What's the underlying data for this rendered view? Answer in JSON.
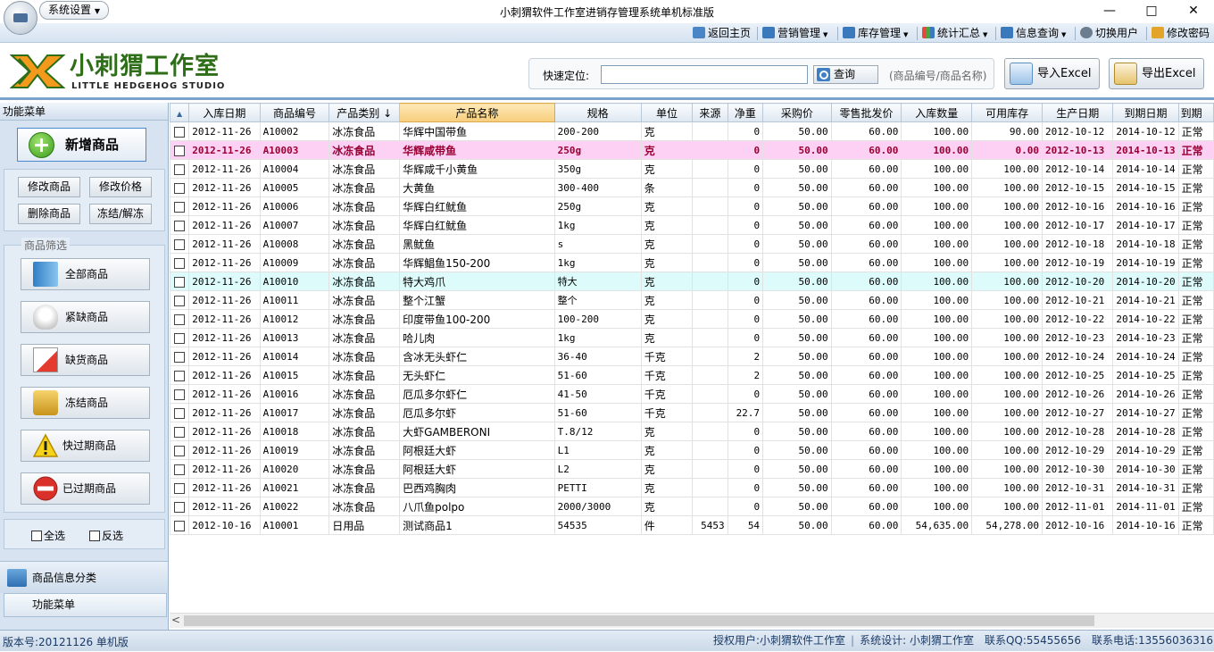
{
  "app": {
    "title": "小刺猬软件工作室进销存管理系统单机标准版",
    "settings_menu": "系统设置",
    "controls": {
      "minimize": "—",
      "maximize": "□",
      "close": "✕"
    }
  },
  "menubar": [
    {
      "label": "返回主页",
      "icon": "home-icon",
      "dropdown": false
    },
    {
      "label": "营销管理",
      "icon": "sales-icon",
      "dropdown": true
    },
    {
      "label": "库存管理",
      "icon": "inventory-icon",
      "dropdown": true
    },
    {
      "label": "统计汇总",
      "icon": "stats-icon",
      "dropdown": true
    },
    {
      "label": "信息查询",
      "icon": "query-icon",
      "dropdown": true
    },
    {
      "label": "切换用户",
      "icon": "switch-user-icon",
      "dropdown": false
    },
    {
      "label": "修改密码",
      "icon": "lock-icon",
      "dropdown": false
    }
  ],
  "header": {
    "logo_cn": "小刺猬工作室",
    "logo_en": "LITTLE HEDGEHOG STUDIO",
    "search_label": "快速定位:",
    "search_value": "",
    "search_button": "查询",
    "search_hint": "(商品编号/商品名称)",
    "import_label": "导入Excel",
    "export_label": "导出Excel"
  },
  "sidebar": {
    "title": "功能菜单",
    "new_item": "新增商品",
    "edit_item": "修改商品",
    "edit_price": "修改价格",
    "delete_item": "删除商品",
    "freeze": "冻结/解冻",
    "filter_group": "商品筛选",
    "filters": [
      {
        "label": "全部商品",
        "icon": "all-items-icon"
      },
      {
        "label": "紧缺商品",
        "icon": "lightbulb-icon"
      },
      {
        "label": "缺货商品",
        "icon": "out-of-stock-icon"
      },
      {
        "label": "冻结商品",
        "icon": "padlock-icon"
      },
      {
        "label": "快过期商品",
        "icon": "warning-icon"
      },
      {
        "label": "已过期商品",
        "icon": "no-entry-icon"
      }
    ],
    "select_all": "全选",
    "invert": "反选",
    "category": "商品信息分类",
    "func_menu": "功能菜单"
  },
  "table": {
    "sort_column": "产品类别",
    "sort_indicator": "↓",
    "columns": [
      "入库日期",
      "商品编号",
      "产品类别",
      "产品名称",
      "规格",
      "单位",
      "来源",
      "净重",
      "采购价",
      "零售批发价",
      "入库数量",
      "可用库存",
      "生产日期",
      "到期日期",
      "到期"
    ],
    "rows": [
      {
        "d": "2012-11-26",
        "id": "A10002",
        "cat": "冰冻食品",
        "name": "华辉中国带鱼",
        "spec": "200-200",
        "unit": "克",
        "src": "",
        "wt": "0",
        "buy": "50.00",
        "sell": "60.00",
        "qin": "100.00",
        "stock": "90.00",
        "prod": "2012-10-12",
        "exp": "2014-10-12",
        "st": "正常",
        "cls": ""
      },
      {
        "d": "2012-11-26",
        "id": "A10003",
        "cat": "冰冻食品",
        "name": "华辉咸带鱼",
        "spec": "250g",
        "unit": "克",
        "src": "",
        "wt": "0",
        "buy": "50.00",
        "sell": "60.00",
        "qin": "100.00",
        "stock": "0.00",
        "prod": "2012-10-13",
        "exp": "2014-10-13",
        "st": "正常",
        "cls": "row-warn"
      },
      {
        "d": "2012-11-26",
        "id": "A10004",
        "cat": "冰冻食品",
        "name": "华辉咸千小黄鱼",
        "spec": "350g",
        "unit": "克",
        "src": "",
        "wt": "0",
        "buy": "50.00",
        "sell": "60.00",
        "qin": "100.00",
        "stock": "100.00",
        "prod": "2012-10-14",
        "exp": "2014-10-14",
        "st": "正常",
        "cls": ""
      },
      {
        "d": "2012-11-26",
        "id": "A10005",
        "cat": "冰冻食品",
        "name": "大黄鱼",
        "spec": "300-400",
        "unit": "条",
        "src": "",
        "wt": "0",
        "buy": "50.00",
        "sell": "60.00",
        "qin": "100.00",
        "stock": "100.00",
        "prod": "2012-10-15",
        "exp": "2014-10-15",
        "st": "正常",
        "cls": ""
      },
      {
        "d": "2012-11-26",
        "id": "A10006",
        "cat": "冰冻食品",
        "name": "华辉白红鱿鱼",
        "spec": "250g",
        "unit": "克",
        "src": "",
        "wt": "0",
        "buy": "50.00",
        "sell": "60.00",
        "qin": "100.00",
        "stock": "100.00",
        "prod": "2012-10-16",
        "exp": "2014-10-16",
        "st": "正常",
        "cls": ""
      },
      {
        "d": "2012-11-26",
        "id": "A10007",
        "cat": "冰冻食品",
        "name": "华辉白红鱿鱼",
        "spec": "1kg",
        "unit": "克",
        "src": "",
        "wt": "0",
        "buy": "50.00",
        "sell": "60.00",
        "qin": "100.00",
        "stock": "100.00",
        "prod": "2012-10-17",
        "exp": "2014-10-17",
        "st": "正常",
        "cls": ""
      },
      {
        "d": "2012-11-26",
        "id": "A10008",
        "cat": "冰冻食品",
        "name": "黑鱿鱼",
        "spec": "s",
        "unit": "克",
        "src": "",
        "wt": "0",
        "buy": "50.00",
        "sell": "60.00",
        "qin": "100.00",
        "stock": "100.00",
        "prod": "2012-10-18",
        "exp": "2014-10-18",
        "st": "正常",
        "cls": ""
      },
      {
        "d": "2012-11-26",
        "id": "A10009",
        "cat": "冰冻食品",
        "name": "华辉鲳鱼150-200",
        "spec": "1kg",
        "unit": "克",
        "src": "",
        "wt": "0",
        "buy": "50.00",
        "sell": "60.00",
        "qin": "100.00",
        "stock": "100.00",
        "prod": "2012-10-19",
        "exp": "2014-10-19",
        "st": "正常",
        "cls": ""
      },
      {
        "d": "2012-11-26",
        "id": "A10010",
        "cat": "冰冻食品",
        "name": "特大鸡爪",
        "spec": "特大",
        "unit": "克",
        "src": "",
        "wt": "0",
        "buy": "50.00",
        "sell": "60.00",
        "qin": "100.00",
        "stock": "100.00",
        "prod": "2012-10-20",
        "exp": "2014-10-20",
        "st": "正常",
        "cls": "row-sel"
      },
      {
        "d": "2012-11-26",
        "id": "A10011",
        "cat": "冰冻食品",
        "name": "整个江蟹",
        "spec": "整个",
        "unit": "克",
        "src": "",
        "wt": "0",
        "buy": "50.00",
        "sell": "60.00",
        "qin": "100.00",
        "stock": "100.00",
        "prod": "2012-10-21",
        "exp": "2014-10-21",
        "st": "正常",
        "cls": ""
      },
      {
        "d": "2012-11-26",
        "id": "A10012",
        "cat": "冰冻食品",
        "name": "印度带鱼100-200",
        "spec": "100-200",
        "unit": "克",
        "src": "",
        "wt": "0",
        "buy": "50.00",
        "sell": "60.00",
        "qin": "100.00",
        "stock": "100.00",
        "prod": "2012-10-22",
        "exp": "2014-10-22",
        "st": "正常",
        "cls": ""
      },
      {
        "d": "2012-11-26",
        "id": "A10013",
        "cat": "冰冻食品",
        "name": "哈儿肉",
        "spec": "1kg",
        "unit": "克",
        "src": "",
        "wt": "0",
        "buy": "50.00",
        "sell": "60.00",
        "qin": "100.00",
        "stock": "100.00",
        "prod": "2012-10-23",
        "exp": "2014-10-23",
        "st": "正常",
        "cls": ""
      },
      {
        "d": "2012-11-26",
        "id": "A10014",
        "cat": "冰冻食品",
        "name": "含冰无头虾仁",
        "spec": "36-40",
        "unit": "千克",
        "src": "",
        "wt": "2",
        "buy": "50.00",
        "sell": "60.00",
        "qin": "100.00",
        "stock": "100.00",
        "prod": "2012-10-24",
        "exp": "2014-10-24",
        "st": "正常",
        "cls": ""
      },
      {
        "d": "2012-11-26",
        "id": "A10015",
        "cat": "冰冻食品",
        "name": "无头虾仁",
        "spec": "51-60",
        "unit": "千克",
        "src": "",
        "wt": "2",
        "buy": "50.00",
        "sell": "60.00",
        "qin": "100.00",
        "stock": "100.00",
        "prod": "2012-10-25",
        "exp": "2014-10-25",
        "st": "正常",
        "cls": ""
      },
      {
        "d": "2012-11-26",
        "id": "A10016",
        "cat": "冰冻食品",
        "name": "厄瓜多尔虾仁",
        "spec": "41-50",
        "unit": "千克",
        "src": "",
        "wt": "0",
        "buy": "50.00",
        "sell": "60.00",
        "qin": "100.00",
        "stock": "100.00",
        "prod": "2012-10-26",
        "exp": "2014-10-26",
        "st": "正常",
        "cls": ""
      },
      {
        "d": "2012-11-26",
        "id": "A10017",
        "cat": "冰冻食品",
        "name": "厄瓜多尔虾",
        "spec": "51-60",
        "unit": "千克",
        "src": "",
        "wt": "22.7",
        "buy": "50.00",
        "sell": "60.00",
        "qin": "100.00",
        "stock": "100.00",
        "prod": "2012-10-27",
        "exp": "2014-10-27",
        "st": "正常",
        "cls": ""
      },
      {
        "d": "2012-11-26",
        "id": "A10018",
        "cat": "冰冻食品",
        "name": "大虾GAMBERONI",
        "spec": "T.8/12",
        "unit": "克",
        "src": "",
        "wt": "0",
        "buy": "50.00",
        "sell": "60.00",
        "qin": "100.00",
        "stock": "100.00",
        "prod": "2012-10-28",
        "exp": "2014-10-28",
        "st": "正常",
        "cls": ""
      },
      {
        "d": "2012-11-26",
        "id": "A10019",
        "cat": "冰冻食品",
        "name": "阿根廷大虾",
        "spec": "L1",
        "unit": "克",
        "src": "",
        "wt": "0",
        "buy": "50.00",
        "sell": "60.00",
        "qin": "100.00",
        "stock": "100.00",
        "prod": "2012-10-29",
        "exp": "2014-10-29",
        "st": "正常",
        "cls": ""
      },
      {
        "d": "2012-11-26",
        "id": "A10020",
        "cat": "冰冻食品",
        "name": "阿根廷大虾",
        "spec": "L2",
        "unit": "克",
        "src": "",
        "wt": "0",
        "buy": "50.00",
        "sell": "60.00",
        "qin": "100.00",
        "stock": "100.00",
        "prod": "2012-10-30",
        "exp": "2014-10-30",
        "st": "正常",
        "cls": ""
      },
      {
        "d": "2012-11-26",
        "id": "A10021",
        "cat": "冰冻食品",
        "name": "巴西鸡胸肉",
        "spec": "PETTI",
        "unit": "克",
        "src": "",
        "wt": "0",
        "buy": "50.00",
        "sell": "60.00",
        "qin": "100.00",
        "stock": "100.00",
        "prod": "2012-10-31",
        "exp": "2014-10-31",
        "st": "正常",
        "cls": ""
      },
      {
        "d": "2012-11-26",
        "id": "A10022",
        "cat": "冰冻食品",
        "name": "八爪鱼polpo",
        "spec": "2000/3000",
        "unit": "克",
        "src": "",
        "wt": "0",
        "buy": "50.00",
        "sell": "60.00",
        "qin": "100.00",
        "stock": "100.00",
        "prod": "2012-11-01",
        "exp": "2014-11-01",
        "st": "正常",
        "cls": ""
      },
      {
        "d": "2012-10-16",
        "id": "A10001",
        "cat": "日用品",
        "name": "测试商品1",
        "spec": "54535",
        "unit": "件",
        "src": "5453",
        "wt": "54",
        "buy": "50.00",
        "sell": "60.00",
        "qin": "54,635.00",
        "stock": "54,278.00",
        "prod": "2012-10-16",
        "exp": "2014-10-16",
        "st": "正常",
        "cls": ""
      }
    ]
  },
  "status": {
    "version": "版本号:20121126 单机版",
    "user": "授权用户:小刺猬软件工作室",
    "design": "系统设计: 小刺猬工作室",
    "qq": "联系QQ:55455656",
    "phone": "联系电话:13556036316"
  }
}
